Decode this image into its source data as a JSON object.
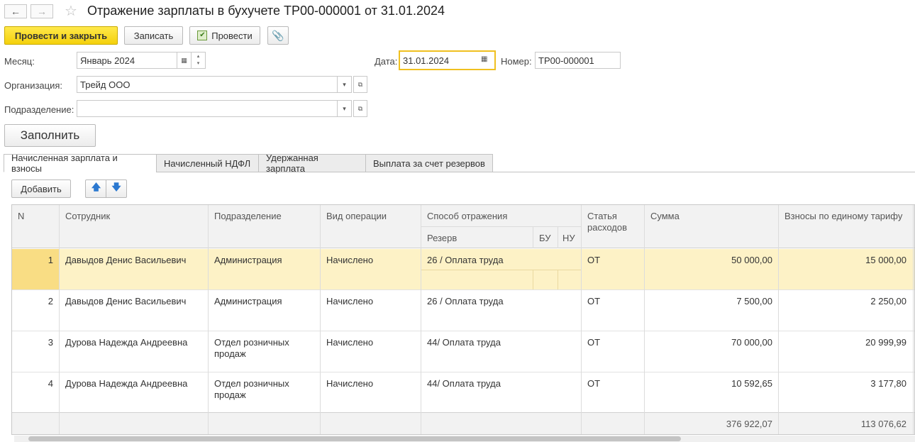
{
  "window": {
    "title": "Отражение зарплаты в бухучете ТР00-000001 от 31.01.2024"
  },
  "toolbar": {
    "post_close": "Провести и закрыть",
    "save": "Записать",
    "post": "Провести"
  },
  "form": {
    "month_label": "Месяц:",
    "month_value": "Январь 2024",
    "date_label": "Дата:",
    "date_value": "31.01.2024",
    "number_label": "Номер:",
    "number_value": "ТР00-000001",
    "org_label": "Организация:",
    "org_value": "Трейд ООО",
    "dept_label": "Подразделение:",
    "dept_value": "",
    "fill_button": "Заполнить"
  },
  "tabs": [
    {
      "label": "Начисленная зарплата и взносы",
      "active": true
    },
    {
      "label": "Начисленный НДФЛ",
      "active": false
    },
    {
      "label": "Удержанная зарплата",
      "active": false
    },
    {
      "label": "Выплата за счет резервов",
      "active": false
    }
  ],
  "table_toolbar": {
    "add": "Добавить"
  },
  "table": {
    "headers": {
      "n": "N",
      "employee": "Сотрудник",
      "dept": "Подразделение",
      "operation": "Вид операции",
      "method": "Способ отражения",
      "reserve": "Резерв",
      "bu": "БУ",
      "nu": "НУ",
      "expense": "Статья расходов",
      "sum": "Сумма",
      "contrib": "Взносы по единому тарифу"
    },
    "rows": [
      {
        "n": "1",
        "employee": "Давыдов Денис Васильевич",
        "dept": "Администрация",
        "operation": "Начислено",
        "method": "26 / Оплата труда",
        "expense": "ОТ",
        "sum": "50 000,00",
        "contrib": "15 000,00"
      },
      {
        "n": "2",
        "employee": "Давыдов Денис Васильевич",
        "dept": "Администрация",
        "operation": "Начислено",
        "method": "26 / Оплата труда",
        "expense": "ОТ",
        "sum": "7 500,00",
        "contrib": "2 250,00"
      },
      {
        "n": "3",
        "employee": "Дурова Надежда Андреевна",
        "dept": "Отдел розничных продаж",
        "operation": "Начислено",
        "method": "44/ Оплата труда",
        "expense": "ОТ",
        "sum": "70 000,00",
        "contrib": "20 999,99"
      },
      {
        "n": "4",
        "employee": "Дурова Надежда Андреевна",
        "dept": "Отдел розничных продаж",
        "operation": "Начислено",
        "method": "44/ Оплата труда",
        "expense": "ОТ",
        "sum": "10 592,65",
        "contrib": "3 177,80"
      }
    ],
    "totals": {
      "sum": "376 922,07",
      "contrib": "113 076,62"
    }
  },
  "icons": {
    "back": "arrow-left-icon",
    "forward": "arrow-right-icon",
    "favorite": "star-icon",
    "attach": "paperclip-icon",
    "calendar": "calendar-icon",
    "dropdown": "chevron-down-icon",
    "open": "open-icon",
    "up": "arrow-up-icon",
    "down": "arrow-down-icon"
  },
  "colors": {
    "primary_button": "#f4d10c",
    "selected_row": "#fdf2c6",
    "focus_border": "#f0c020"
  }
}
